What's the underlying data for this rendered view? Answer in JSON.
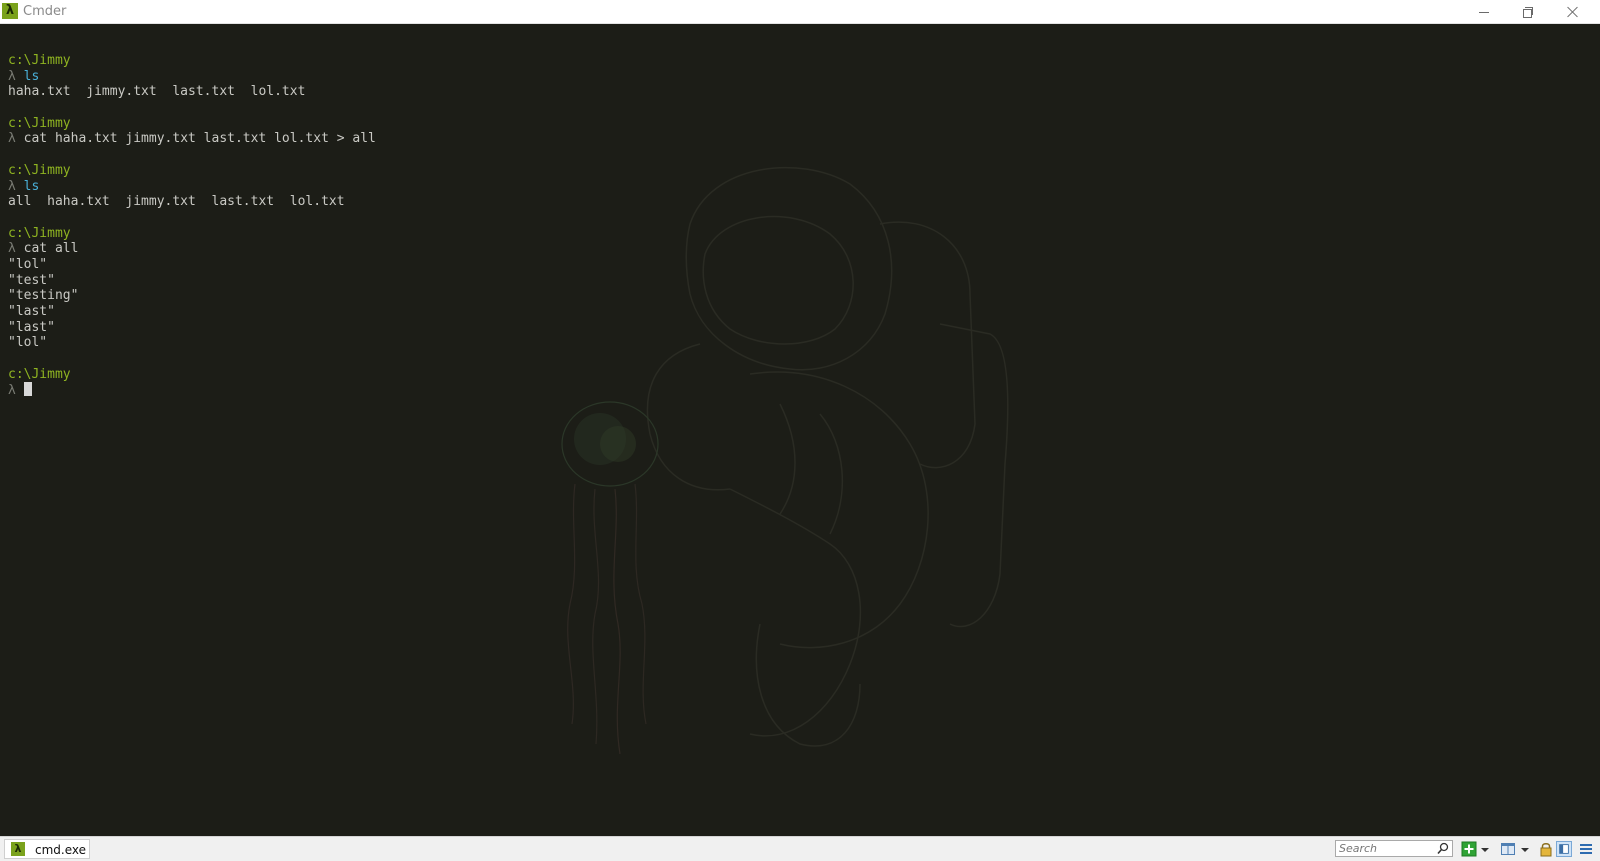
{
  "window": {
    "title": "Cmder",
    "app_icon": "λ"
  },
  "terminal": {
    "lines": [
      {
        "kind": "path",
        "text": "c:\\Jimmy"
      },
      {
        "kind": "prompt",
        "lambda": "λ",
        "command": "ls",
        "style": "blue"
      },
      {
        "kind": "output",
        "text": "haha.txt  jimmy.txt  last.txt  lol.txt"
      },
      {
        "kind": "blank",
        "text": ""
      },
      {
        "kind": "path",
        "text": "c:\\Jimmy"
      },
      {
        "kind": "prompt",
        "lambda": "λ",
        "command": "cat haha.txt jimmy.txt last.txt lol.txt > all",
        "style": "plain"
      },
      {
        "kind": "blank",
        "text": ""
      },
      {
        "kind": "path",
        "text": "c:\\Jimmy"
      },
      {
        "kind": "prompt",
        "lambda": "λ",
        "command": "ls",
        "style": "blue"
      },
      {
        "kind": "output",
        "text": "all  haha.txt  jimmy.txt  last.txt  lol.txt"
      },
      {
        "kind": "blank",
        "text": ""
      },
      {
        "kind": "path",
        "text": "c:\\Jimmy"
      },
      {
        "kind": "prompt",
        "lambda": "λ",
        "command": "cat all",
        "style": "plain"
      },
      {
        "kind": "output",
        "text": "\"lol\""
      },
      {
        "kind": "output",
        "text": "\"test\""
      },
      {
        "kind": "output",
        "text": "\"testing\""
      },
      {
        "kind": "output",
        "text": "\"last\""
      },
      {
        "kind": "output",
        "text": "\"last\""
      },
      {
        "kind": "output",
        "text": "\"lol\""
      },
      {
        "kind": "blank",
        "text": ""
      },
      {
        "kind": "path",
        "text": "c:\\Jimmy"
      },
      {
        "kind": "cursor",
        "lambda": "λ"
      }
    ],
    "colors": {
      "background": "#1c1d17",
      "path": "#8fb421",
      "lambda": "#7a7c74",
      "command_blue": "#4ab0d8",
      "output": "#c9c9c4"
    }
  },
  "statusbar": {
    "tab_label": "cmd.exe",
    "tab_icon": "λ",
    "search_placeholder": "Search",
    "search_value": "",
    "icons": [
      "search-icon",
      "add-console-icon",
      "dropdown-arrow-icon",
      "split-view-icon",
      "dropdown-arrow-icon",
      "lock-icon",
      "layout-icon",
      "menu-icon"
    ]
  }
}
